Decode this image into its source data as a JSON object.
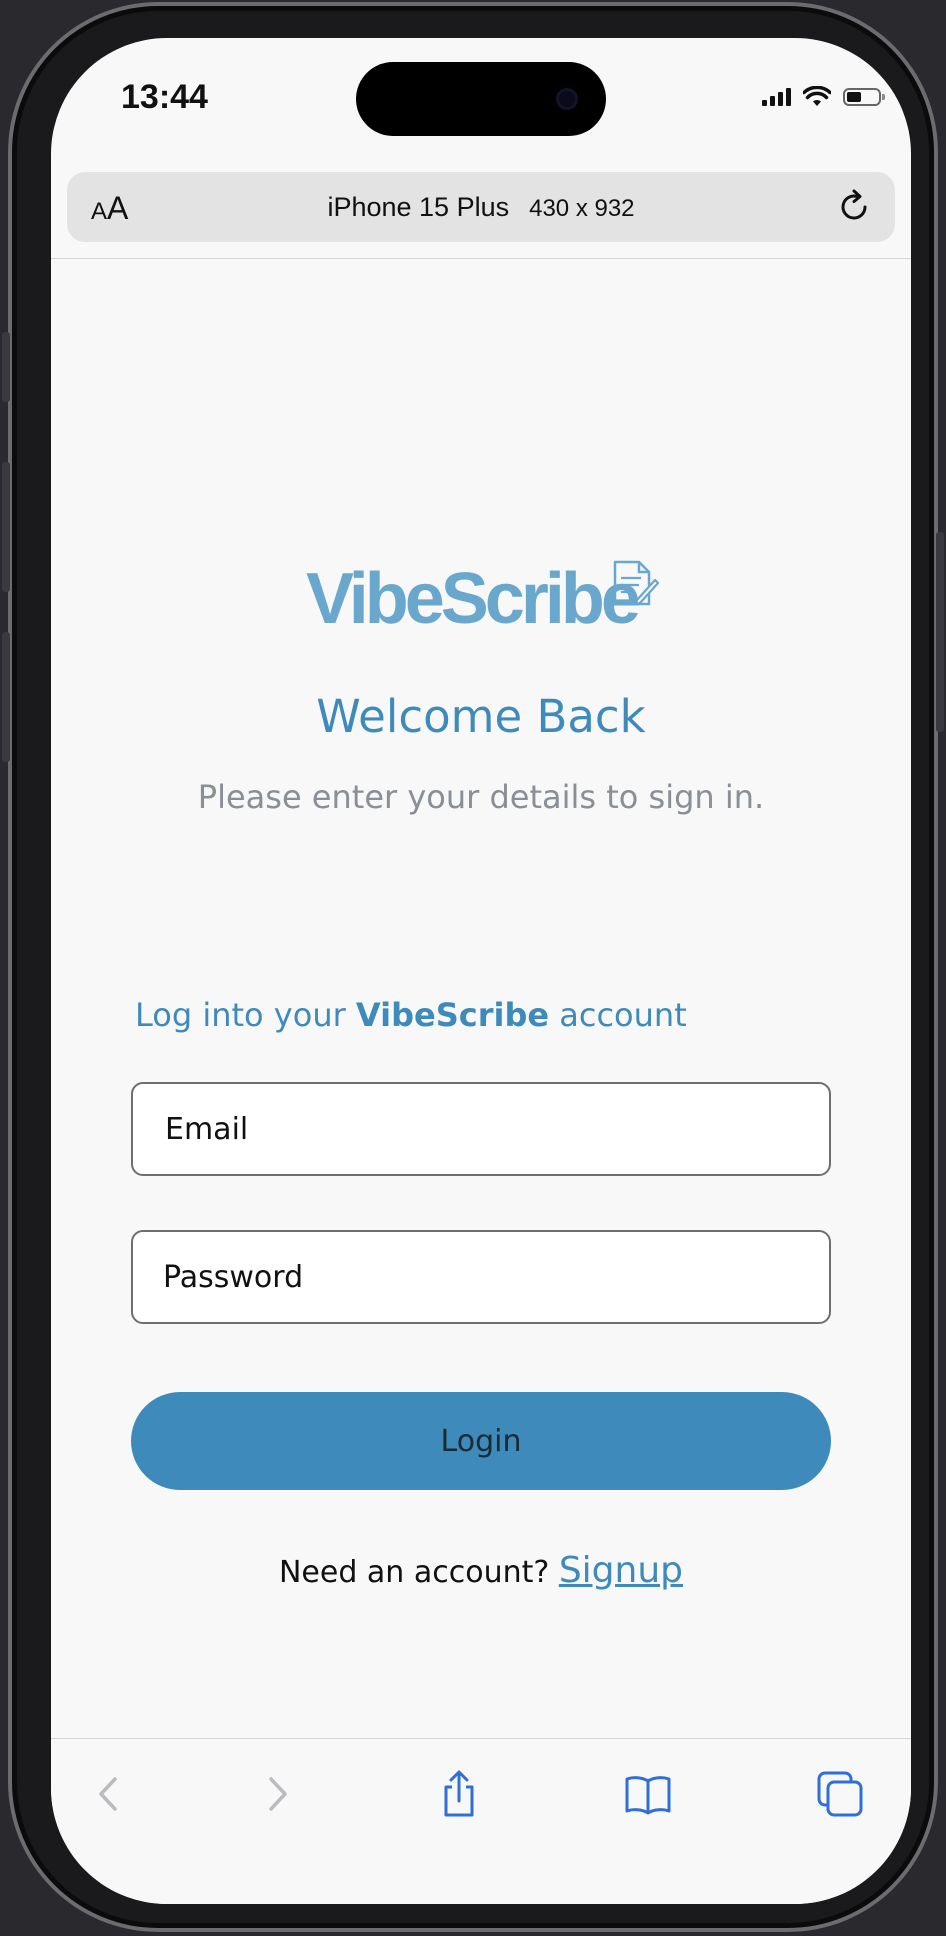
{
  "status_bar": {
    "time": "13:44"
  },
  "browser": {
    "text_size_small": "A",
    "text_size_large": "A",
    "device_name": "iPhone 15 Plus",
    "device_dims": "430 x 932",
    "icons": [
      "reload-icon",
      "back-icon",
      "forward-icon",
      "share-icon",
      "bookmarks-icon",
      "tabs-icon"
    ]
  },
  "page": {
    "logo_text": "VibeScribe",
    "title": "Welcome Back",
    "subtitle": "Please enter your details to sign in.",
    "form_heading_prefix": "Log into your ",
    "form_heading_brand": "VibeScribe",
    "form_heading_suffix": " account",
    "email_placeholder": "Email",
    "password_placeholder": "Password",
    "login_label": "Login",
    "signup_prompt": "Need an account? ",
    "signup_link": "Signup"
  },
  "colors": {
    "brand": "#3e8bbb",
    "logo": "#6aa7cd",
    "ios_accent": "#2f6fd6"
  }
}
